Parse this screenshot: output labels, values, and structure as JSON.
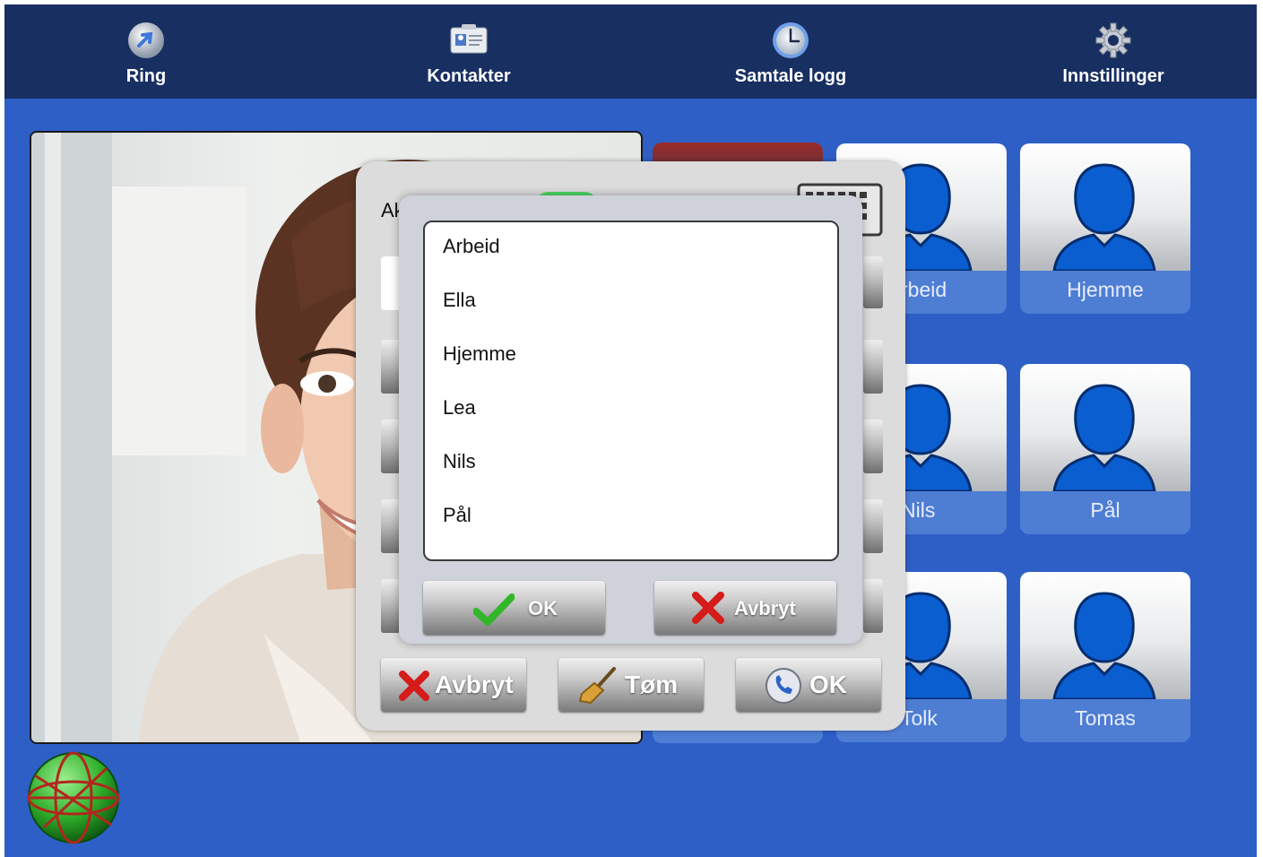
{
  "nav": [
    {
      "label": "Ring",
      "icon": "call-arrow-icon"
    },
    {
      "label": "Kontakter",
      "icon": "contact-card-icon"
    },
    {
      "label": "Samtale logg",
      "icon": "clock-icon"
    },
    {
      "label": "Innstillinger",
      "icon": "gear-icon"
    }
  ],
  "contacts": [
    {
      "label": "Arbeid",
      "visible_label": "rbeid"
    },
    {
      "label": "Hjemme"
    },
    {
      "label": "Nils",
      "visible_label": "Nils"
    },
    {
      "label": "Pål"
    },
    {
      "label": "Tolk",
      "visible_label": "Tolk"
    },
    {
      "label": "Tomas"
    }
  ],
  "dialog": {
    "partial_label": "Ak",
    "buttons": {
      "cancel": "Avbryt",
      "clear": "Tøm",
      "ok": "OK"
    },
    "icons": [
      "keyboard-icon",
      "red-x-icon",
      "broom-icon",
      "phone-call-icon"
    ]
  },
  "picker": {
    "items": [
      "Arbeid",
      "Ella",
      "Hjemme",
      "Lea",
      "Nils",
      "Pål"
    ],
    "ok_label": "OK",
    "cancel_label": "Avbryt"
  },
  "colors": {
    "background": "#2d5fc7",
    "navbar": "#182f62",
    "tile": "#4e7dd4",
    "silhouette": "#0a5ed0"
  },
  "status_icon": "globe-network-icon"
}
